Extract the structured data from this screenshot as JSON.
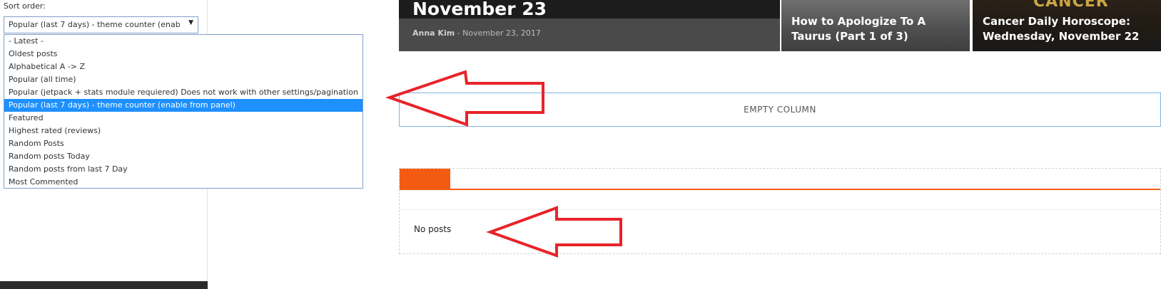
{
  "sidebar": {
    "sort_label": "Sort order:",
    "select_value": "Popular (last 7 days) - theme counter (enable from panel)",
    "options": [
      "- Latest -",
      "Oldest posts",
      "Alphabetical A -> Z",
      "Popular (all time)",
      "Popular (jetpack + stats module requiered) Does not work with other settings/pagination",
      "Popular (last 7 days) - theme counter (enable from panel)",
      "Featured",
      "Highest rated (reviews)",
      "Random Posts",
      "Random posts Today",
      "Random posts from last 7 Day",
      "Most Commented"
    ],
    "selected_index": 5
  },
  "featured": {
    "title": "November 23",
    "author": "Anna Kim",
    "separator": "-",
    "date": "November 23, 2017"
  },
  "cards": [
    {
      "title": "How to Apologize To A Taurus (Part 1 of 3)"
    },
    {
      "title": "Cancer Daily Horoscope: Wednesday, November 22",
      "overlay_text": "CANCER"
    }
  ],
  "empty_column": {
    "text": "EMPTY COLUMN"
  },
  "posts_block": {
    "empty_text": "No posts"
  },
  "colors": {
    "accent_orange": "#f35b13",
    "selection_blue": "#1e90ff",
    "annotation_red": "#e8232a"
  }
}
